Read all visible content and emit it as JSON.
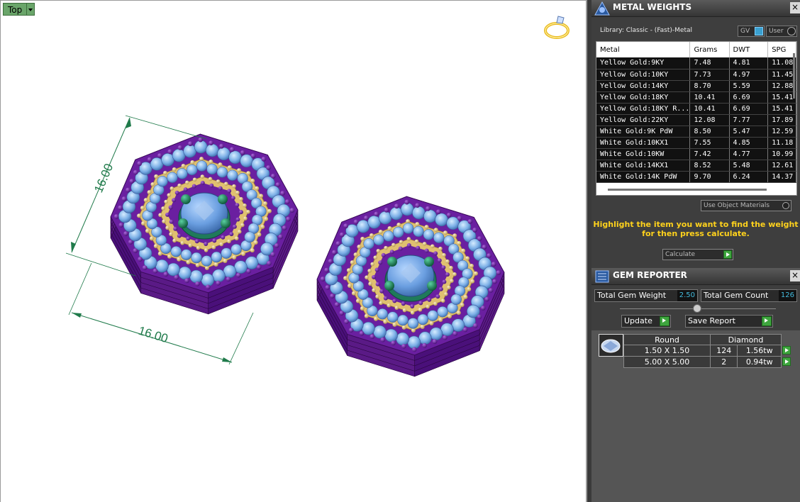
{
  "viewport": {
    "view_name": "Top",
    "dimensions": {
      "vertical": "16.00",
      "horizontal": "16.00"
    }
  },
  "metal_weights": {
    "title": "METAL WEIGHTS",
    "close": "×",
    "library": "Library: Classic - (Fast)-Metal",
    "toggle_gv": "GV",
    "toggle_user": "User",
    "columns": [
      "Metal",
      "Grams",
      "DWT",
      "SPG"
    ],
    "rows": [
      [
        "Yellow Gold:9KY",
        "7.48",
        "4.81",
        "11.08"
      ],
      [
        "Yellow Gold:10KY",
        "7.73",
        "4.97",
        "11.45"
      ],
      [
        "Yellow Gold:14KY",
        "8.70",
        "5.59",
        "12.88"
      ],
      [
        "Yellow Gold:18KY",
        "10.41",
        "6.69",
        "15.41"
      ],
      [
        "Yellow Gold:18KY R...",
        "10.41",
        "6.69",
        "15.41"
      ],
      [
        "Yellow Gold:22KY",
        "12.08",
        "7.77",
        "17.89"
      ],
      [
        "White Gold:9K PdW",
        "8.50",
        "5.47",
        "12.59"
      ],
      [
        "White Gold:10KX1",
        "7.55",
        "4.85",
        "11.18"
      ],
      [
        "White Gold:10KW",
        "7.42",
        "4.77",
        "10.99"
      ],
      [
        "White Gold:14KX1",
        "8.52",
        "5.48",
        "12.61"
      ],
      [
        "White Gold:14K PdW",
        "9.70",
        "6.24",
        "14.37"
      ]
    ],
    "use_object_materials": "Use Object Materials",
    "hint": "Highlight the item you want to find the weight for then press calculate.",
    "calculate": "Calculate"
  },
  "gem_reporter": {
    "title": "GEM REPORTER",
    "close": "×",
    "total_weight_label": "Total Gem Weight",
    "total_weight_value": "2.50",
    "total_count_label": "Total Gem Count",
    "total_count_value": "126",
    "update_label": "Update",
    "save_report_label": "Save Report",
    "table_header": [
      "Round",
      "Diamond"
    ],
    "rows": [
      {
        "size": "1.50 X 1.50",
        "count": "124",
        "weight": "1.56tw"
      },
      {
        "size": "5.00 X 5.00",
        "count": "2",
        "weight": "0.94tw"
      }
    ]
  },
  "colors": {
    "accent_yellow": "#ffd21c",
    "go_green": "#3ea53e",
    "gem_blue": "#7aaee6",
    "setting_purple": "#6a1fa0",
    "gold": "#e0c070",
    "prong_green": "#1f7a5a"
  }
}
